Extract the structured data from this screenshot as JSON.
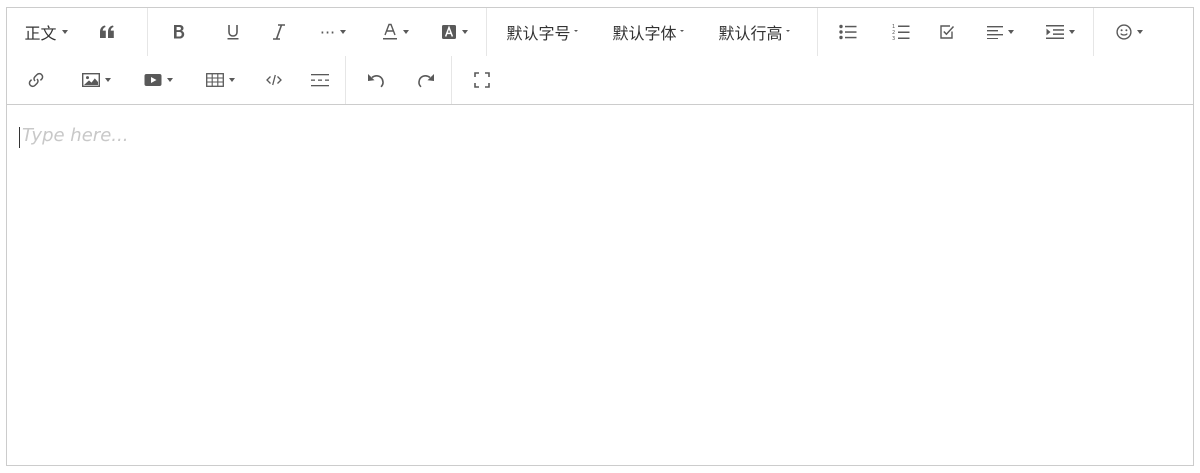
{
  "toolbar": {
    "row1": {
      "paragraph_label": "正文",
      "font_size_label": "默认字号",
      "font_family_label": "默认字体",
      "line_height_label": "默认行高",
      "more_label": "···"
    }
  },
  "editor": {
    "placeholder": "Type here..."
  },
  "icons": [
    "quote-icon",
    "bold-icon",
    "underline-icon",
    "italic-icon",
    "more-icon",
    "font-color-icon",
    "background-color-icon",
    "bulleted-list-icon",
    "numbered-list-icon",
    "todo-icon",
    "justify-icon",
    "indent-icon",
    "emotion-icon",
    "link-icon",
    "image-icon",
    "video-icon",
    "table-icon",
    "code-block-icon",
    "divider-icon",
    "undo-icon",
    "redo-icon",
    "fullscreen-icon"
  ],
  "colors": {
    "border": "#cccccc",
    "icon": "#595959",
    "placeholder": "#c8c8c8"
  }
}
